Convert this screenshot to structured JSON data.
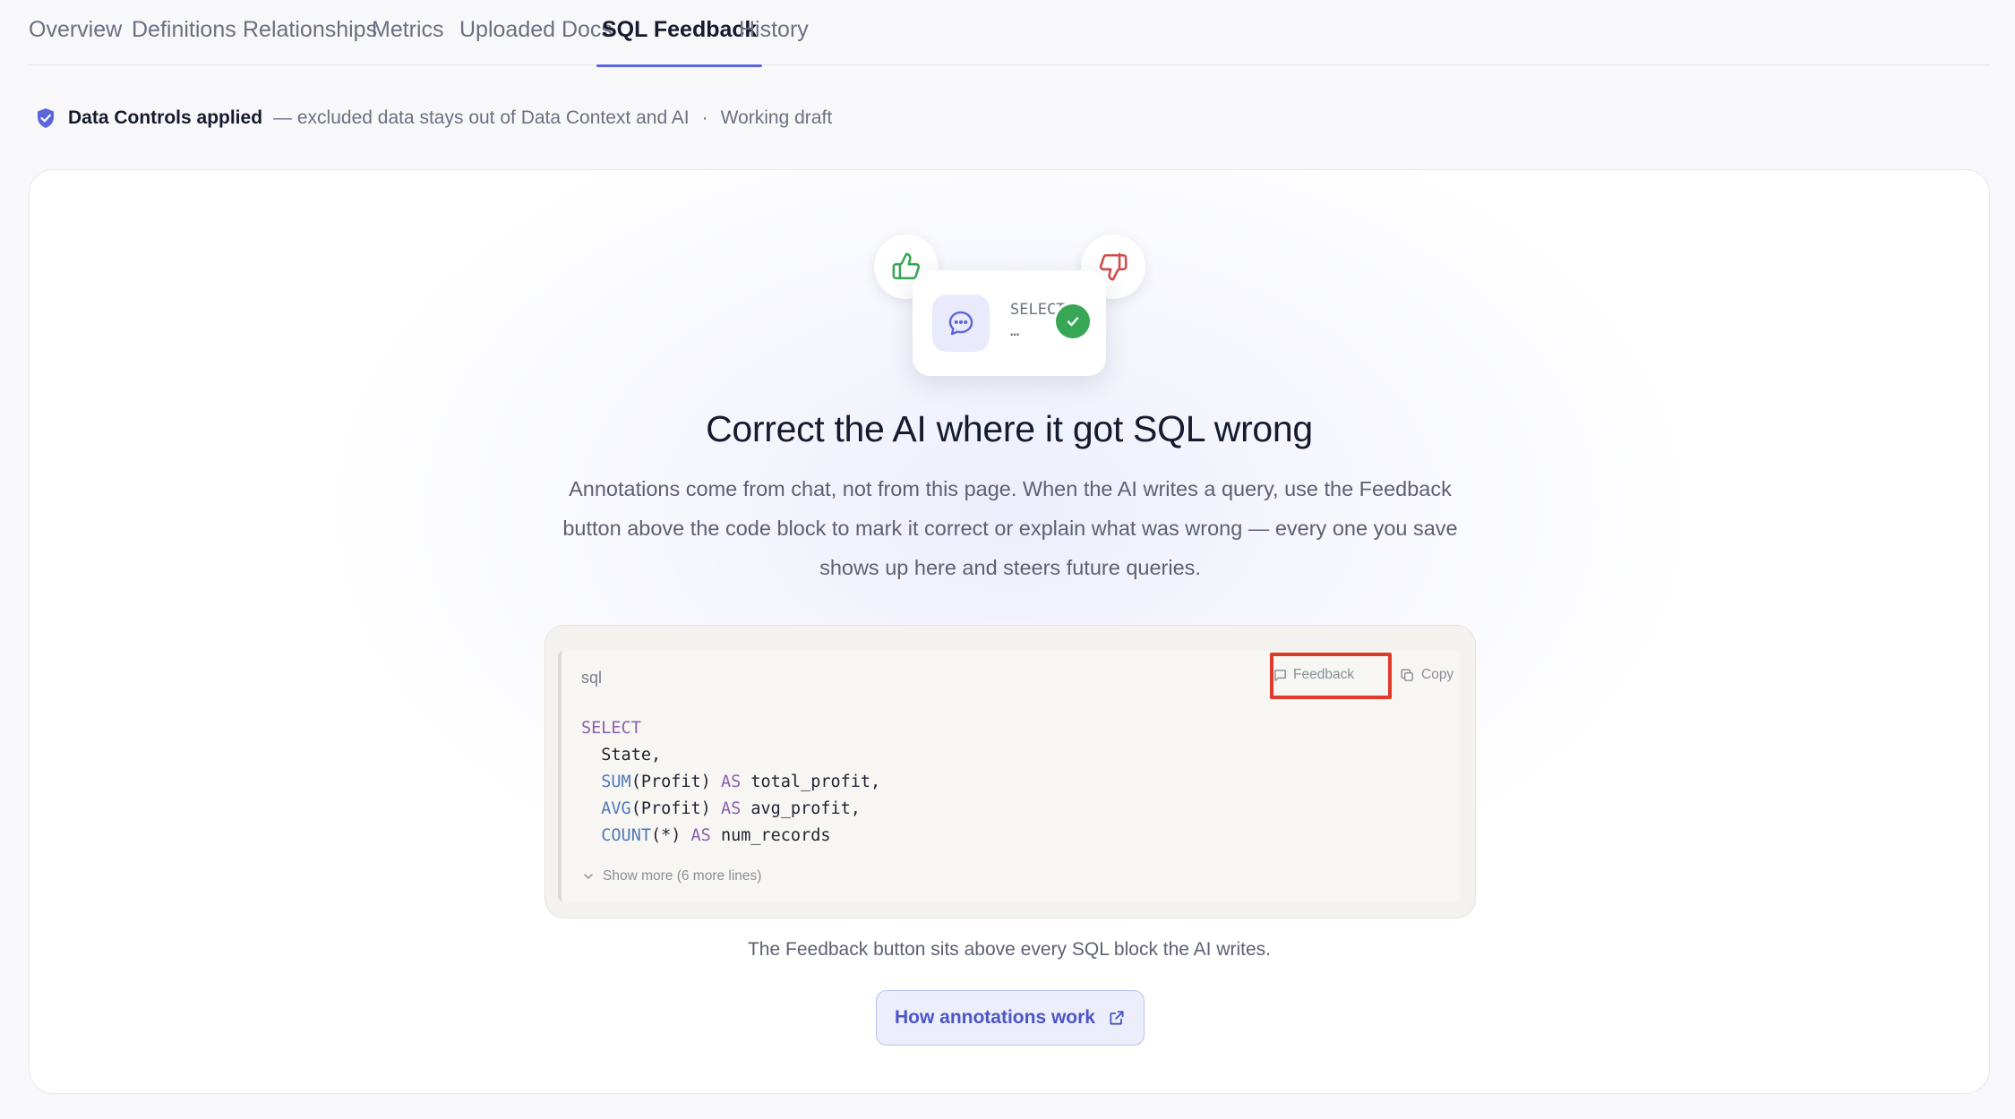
{
  "tabs": [
    {
      "label": "Overview"
    },
    {
      "label": "Definitions"
    },
    {
      "label": "Relationships"
    },
    {
      "label": "Metrics"
    },
    {
      "label": "Uploaded Docs"
    },
    {
      "label": "SQL Feedback",
      "active": true
    },
    {
      "label": "History"
    }
  ],
  "controls": {
    "title": "Data Controls applied",
    "desc": "— excluded data stays out of Data Context and AI",
    "separator": "·",
    "status": "Working draft"
  },
  "illustration": {
    "snippet_line1": "SELECT",
    "snippet_line2": "…"
  },
  "main": {
    "title": "Correct the AI where it got SQL wrong",
    "description": "Annotations come from chat, not from this page. When the AI writes a query, use the Feedback button above the code block to mark it correct or explain what was wrong — every one you save shows up here and steers future queries."
  },
  "code": {
    "lang": "sql",
    "feedback_label": "Feedback",
    "copy_label": "Copy",
    "show_more": "Show more (6 more lines)"
  },
  "footer": {
    "note": "The Feedback button sits above every SQL block the AI writes.",
    "link_label": "How annotations work"
  },
  "colors": {
    "accent": "#5b66dc",
    "highlight": "#e03a2a",
    "success": "#37a655",
    "keyword": "#8a5fb0",
    "function": "#4f79b8"
  }
}
